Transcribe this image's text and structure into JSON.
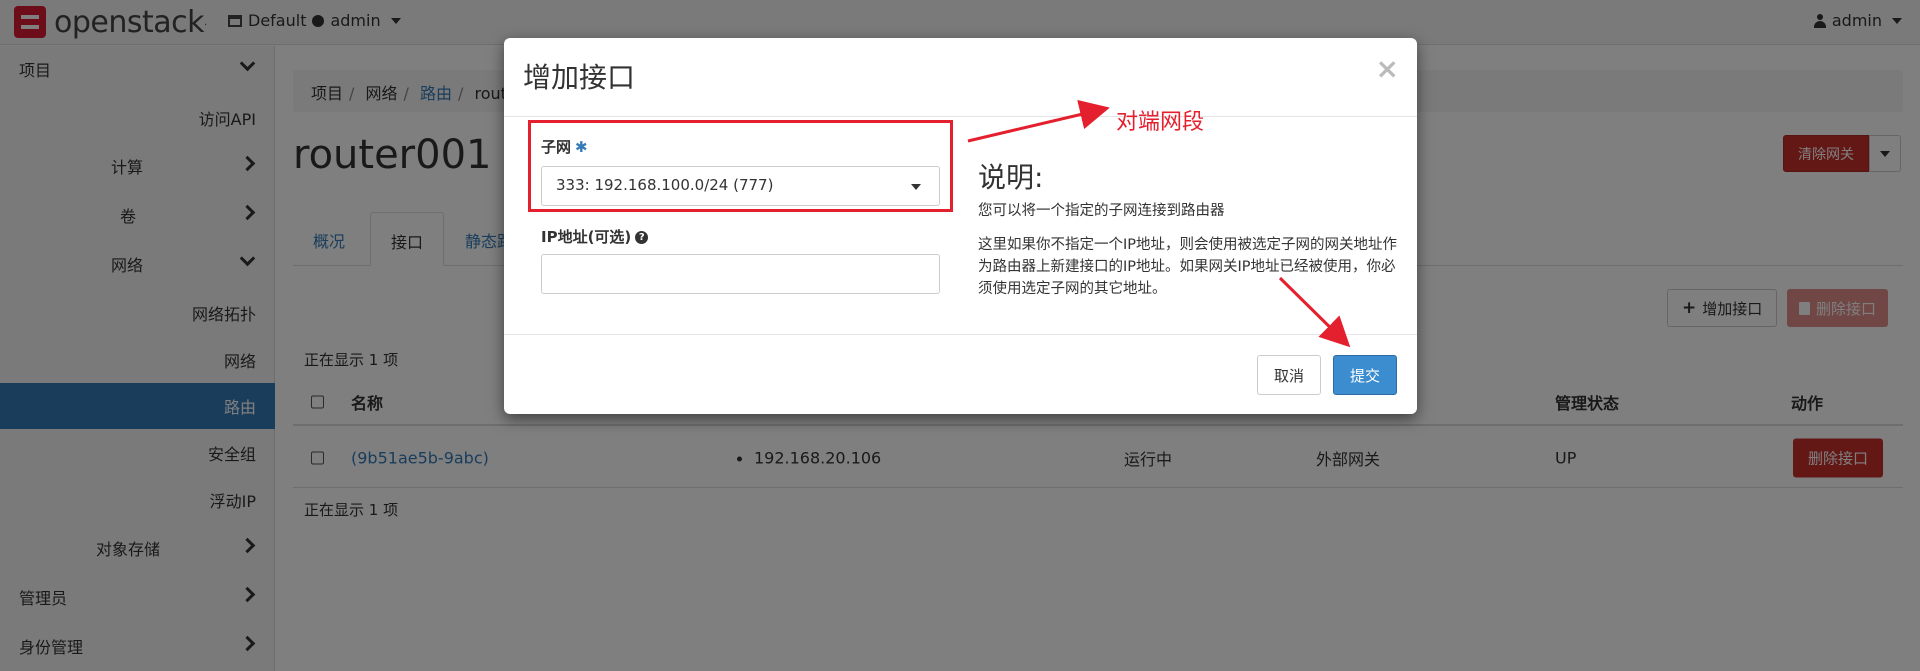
{
  "topbar": {
    "logo_text": "openstack",
    "domain": "Default",
    "project": "admin",
    "user": "admin"
  },
  "sidebar": {
    "items": [
      {
        "label": "项目",
        "chevron": "down"
      },
      {
        "label": "访问API"
      },
      {
        "label": "计算",
        "chevron": "right"
      },
      {
        "label": "卷",
        "chevron": "right"
      },
      {
        "label": "网络",
        "chevron": "down"
      },
      {
        "label": "网络拓扑"
      },
      {
        "label": "网络"
      },
      {
        "label": "路由",
        "active": true
      },
      {
        "label": "安全组"
      },
      {
        "label": "浮动IP"
      },
      {
        "label": "对象存储",
        "chevron": "right"
      },
      {
        "label": "管理员",
        "chevron": "right"
      },
      {
        "label": "身份管理",
        "chevron": "right"
      }
    ]
  },
  "breadcrumb": [
    "项目",
    "网络",
    "路由",
    "rout"
  ],
  "page_title": "router001",
  "clear_gateway_label": "清除网关",
  "tabs": [
    "概况",
    "接口",
    "静态路"
  ],
  "actions": {
    "add_interface": "增加接口",
    "delete_interface": "删除接口"
  },
  "table": {
    "showing_text": "正在显示 1 项",
    "columns": [
      "名称",
      "管理状态",
      "动作"
    ],
    "rows": [
      {
        "name": "(9b51ae5b-9abc)",
        "ip": "192.168.20.106",
        "status": "运行中",
        "type": "外部网关",
        "admin_state": "UP",
        "action": "删除接口"
      }
    ]
  },
  "modal": {
    "title": "增加接口",
    "close": "×",
    "subnet_label": "子网",
    "subnet_required": "✱",
    "subnet_value": "333: 192.168.100.0/24 (777)",
    "ip_label": "IP地址(可选)",
    "ip_value": "",
    "desc_title": "说明:",
    "desc_line1": "您可以将一个指定的子网连接到路由器",
    "desc_line2": "这里如果你不指定一个IP地址，则会使用被选定子网的网关地址作为路由器上新建接口的IP地址。如果网关IP地址已经被使用，你必须使用选定子网的其它地址。",
    "cancel_label": "取消",
    "submit_label": "提交"
  },
  "annotation": {
    "label": "对端网段",
    "color": "#e5202e"
  },
  "colors": {
    "primary": "#337ab7",
    "danger": "#c9302c",
    "submit": "#3c8dcf"
  }
}
